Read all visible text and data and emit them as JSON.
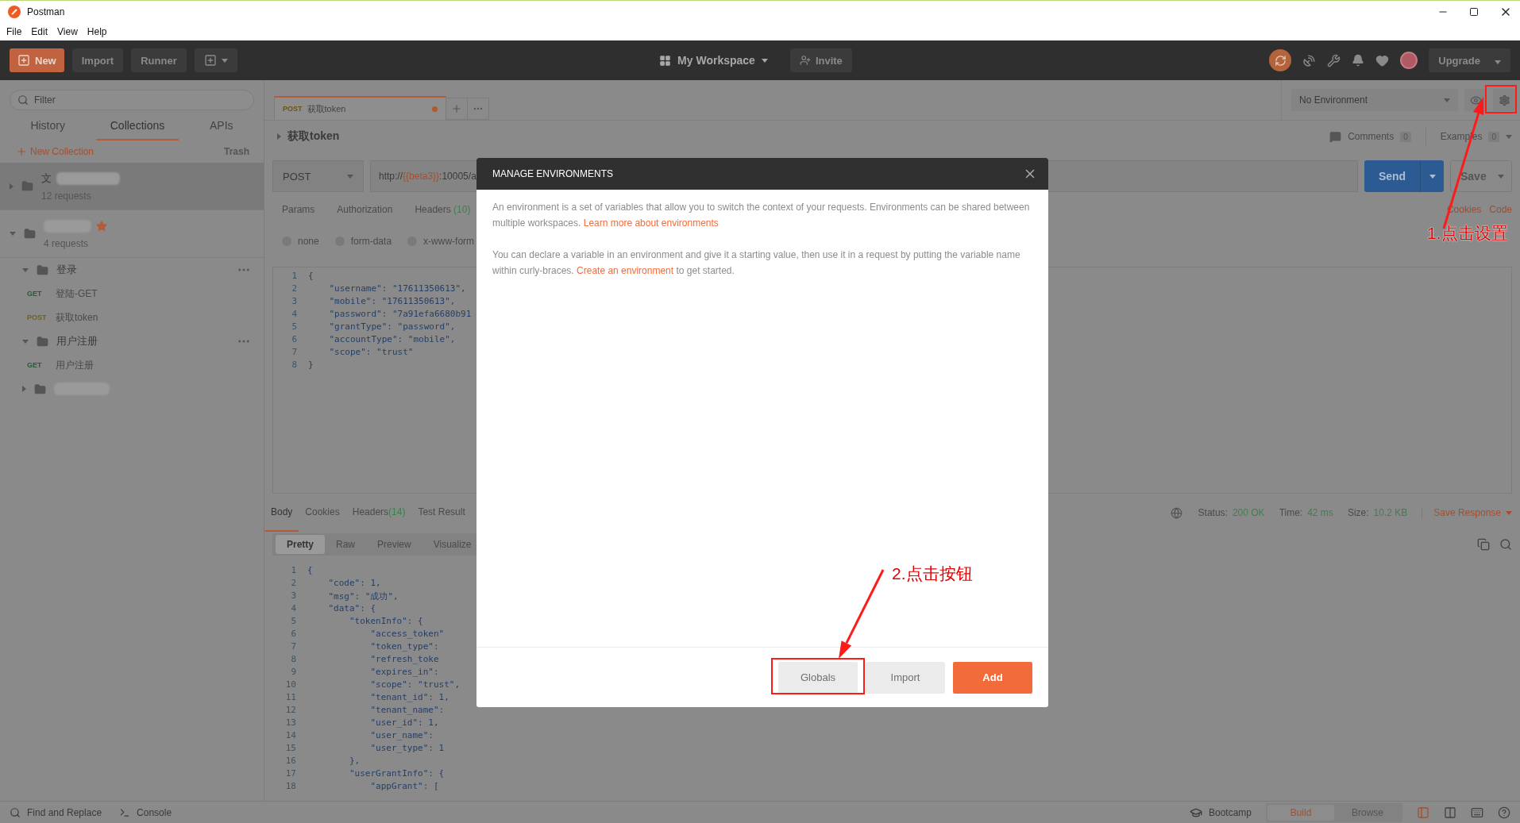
{
  "window": {
    "title": "Postman"
  },
  "menu": [
    "File",
    "Edit",
    "View",
    "Help"
  ],
  "header": {
    "new_label": "New",
    "import_label": "Import",
    "runner_label": "Runner",
    "workspace": "My Workspace",
    "invite": "Invite",
    "upgrade": "Upgrade"
  },
  "sidebar": {
    "filter_placeholder": "Filter",
    "tabs": [
      {
        "label": "History",
        "selected": false
      },
      {
        "label": "Collections",
        "selected": true
      },
      {
        "label": "APIs",
        "selected": false
      }
    ],
    "new_collection": "New Collection",
    "trash": "Trash",
    "collections": [
      {
        "name": "文",
        "requests": "12 requests",
        "redacted": true,
        "expanded": false,
        "selected": true,
        "favorite": false
      },
      {
        "requests": "4 requests",
        "redacted": true,
        "expanded": true,
        "selected": false,
        "favorite": true,
        "children": [
          {
            "kind": "folder",
            "name": "登录",
            "expanded": true,
            "actions_visible": true,
            "children": [
              {
                "kind": "request",
                "method": "GET",
                "color": "#2c5937",
                "name": "登陆-GET"
              },
              {
                "kind": "request",
                "method": "POST",
                "color": "#735f1e",
                "name": "获取token"
              }
            ]
          },
          {
            "kind": "folder",
            "name": "用户注册",
            "expanded": true,
            "actions_visible": true,
            "children": [
              {
                "kind": "request",
                "method": "GET",
                "color": "#2c5937",
                "name": "用户注册"
              }
            ]
          },
          {
            "kind": "folder",
            "redacted": true,
            "expanded": false,
            "actions_visible": false
          }
        ]
      }
    ]
  },
  "request_tab": {
    "method": "POST",
    "name": "获取token",
    "unsaved": true,
    "selected": true
  },
  "environment": "No Environment",
  "request": {
    "name": "获取token",
    "comments_label": "Comments",
    "comments_count": "0",
    "examples_label": "Examples",
    "examples_count": "0",
    "method": "POST",
    "url_prefix": "http://",
    "url_variable": "{{beta3}}",
    "url_suffix": ":10005/a",
    "send": "Send",
    "save": "Save",
    "tabs": [
      {
        "label": "Params",
        "selected": false
      },
      {
        "label": "Authorization",
        "selected": false
      },
      {
        "label": "Headers",
        "count": "(10)",
        "selected": false
      }
    ],
    "links": [
      "Cookies",
      "Code"
    ],
    "body_modes": [
      {
        "label": "none",
        "selected": false
      },
      {
        "label": "form-data",
        "selected": false
      },
      {
        "label": "x-www-form",
        "selected": false
      }
    ],
    "lines": [
      {
        "n": "1",
        "code": "{"
      },
      {
        "n": "2",
        "code": "    \"username\": \"17611350613\","
      },
      {
        "n": "3",
        "code": "    \"mobile\": \"17611350613\","
      },
      {
        "n": "4",
        "code": "    \"password\": \"7a91efa6680b91"
      },
      {
        "n": "5",
        "code": "    \"grantType\": \"password\","
      },
      {
        "n": "6",
        "code": "    \"accountType\": \"mobile\","
      },
      {
        "n": "7",
        "code": "    \"scope\": \"trust\""
      },
      {
        "n": "8",
        "code": "}"
      }
    ]
  },
  "response": {
    "tabs": [
      {
        "label": "Body",
        "selected": true
      },
      {
        "label": "Cookies",
        "selected": false
      },
      {
        "label": "Headers",
        "count": "(14)",
        "selected": false
      },
      {
        "label": "Test Result",
        "selected": false
      }
    ],
    "views": [
      {
        "label": "Pretty",
        "selected": true
      },
      {
        "label": "Raw",
        "selected": false
      },
      {
        "label": "Preview",
        "selected": false
      },
      {
        "label": "Visualize",
        "selected": false
      }
    ],
    "status_label": "Status:",
    "status": "200 OK",
    "time_label": "Time:",
    "time": "42 ms",
    "size_label": "Size:",
    "size": "10.2 KB",
    "save_response": "Save Response",
    "lines": [
      {
        "n": "1",
        "code": "{"
      },
      {
        "n": "2",
        "code": "    \"code\": 1,"
      },
      {
        "n": "3",
        "code": "    \"msg\": \"成功\","
      },
      {
        "n": "4",
        "code": "    \"data\": {"
      },
      {
        "n": "5",
        "code": "        \"tokenInfo\": {"
      },
      {
        "n": "6",
        "code": "            \"access_token\""
      },
      {
        "n": "7",
        "code": "            \"token_type\":"
      },
      {
        "n": "8",
        "code": "            \"refresh_toke"
      },
      {
        "n": "9",
        "code": "            \"expires_in\":"
      },
      {
        "n": "10",
        "code": "            \"scope\": \"trust\","
      },
      {
        "n": "11",
        "code": "            \"tenant_id\": 1,"
      },
      {
        "n": "12",
        "code": "            \"tenant_name\":"
      },
      {
        "n": "13",
        "code": "            \"user_id\": 1,"
      },
      {
        "n": "14",
        "code": "            \"user_name\":"
      },
      {
        "n": "15",
        "code": "            \"user_type\": 1"
      },
      {
        "n": "16",
        "code": "        },"
      },
      {
        "n": "17",
        "code": "        \"userGrantInfo\": {"
      },
      {
        "n": "18",
        "code": "            \"appGrant\": ["
      }
    ]
  },
  "status_bar": {
    "find": "Find and Replace",
    "console": "Console",
    "bootcamp": "Bootcamp",
    "modes": [
      {
        "label": "Build",
        "selected": true
      },
      {
        "label": "Browse",
        "selected": false
      }
    ]
  },
  "modal": {
    "title": "MANAGE ENVIRONMENTS",
    "paragraphs": [
      {
        "text": "An environment is a set of variables that allow you to switch the context of your requests. Environments can be shared between multiple workspaces.",
        "link": "Learn more about environments"
      },
      {
        "text": "You can declare a variable in an environment and give it a starting value, then use it in a request by putting the variable name within curly-braces.",
        "link": "Create an environment",
        "after": "to get started."
      }
    ],
    "buttons": [
      {
        "kind": "secondary",
        "label": "Globals"
      },
      {
        "kind": "secondary",
        "label": "Import"
      },
      {
        "kind": "primary",
        "label": "Add"
      }
    ]
  },
  "annotations": [
    {
      "text": "1.点击设置"
    },
    {
      "text": "2.点击按钮"
    }
  ]
}
